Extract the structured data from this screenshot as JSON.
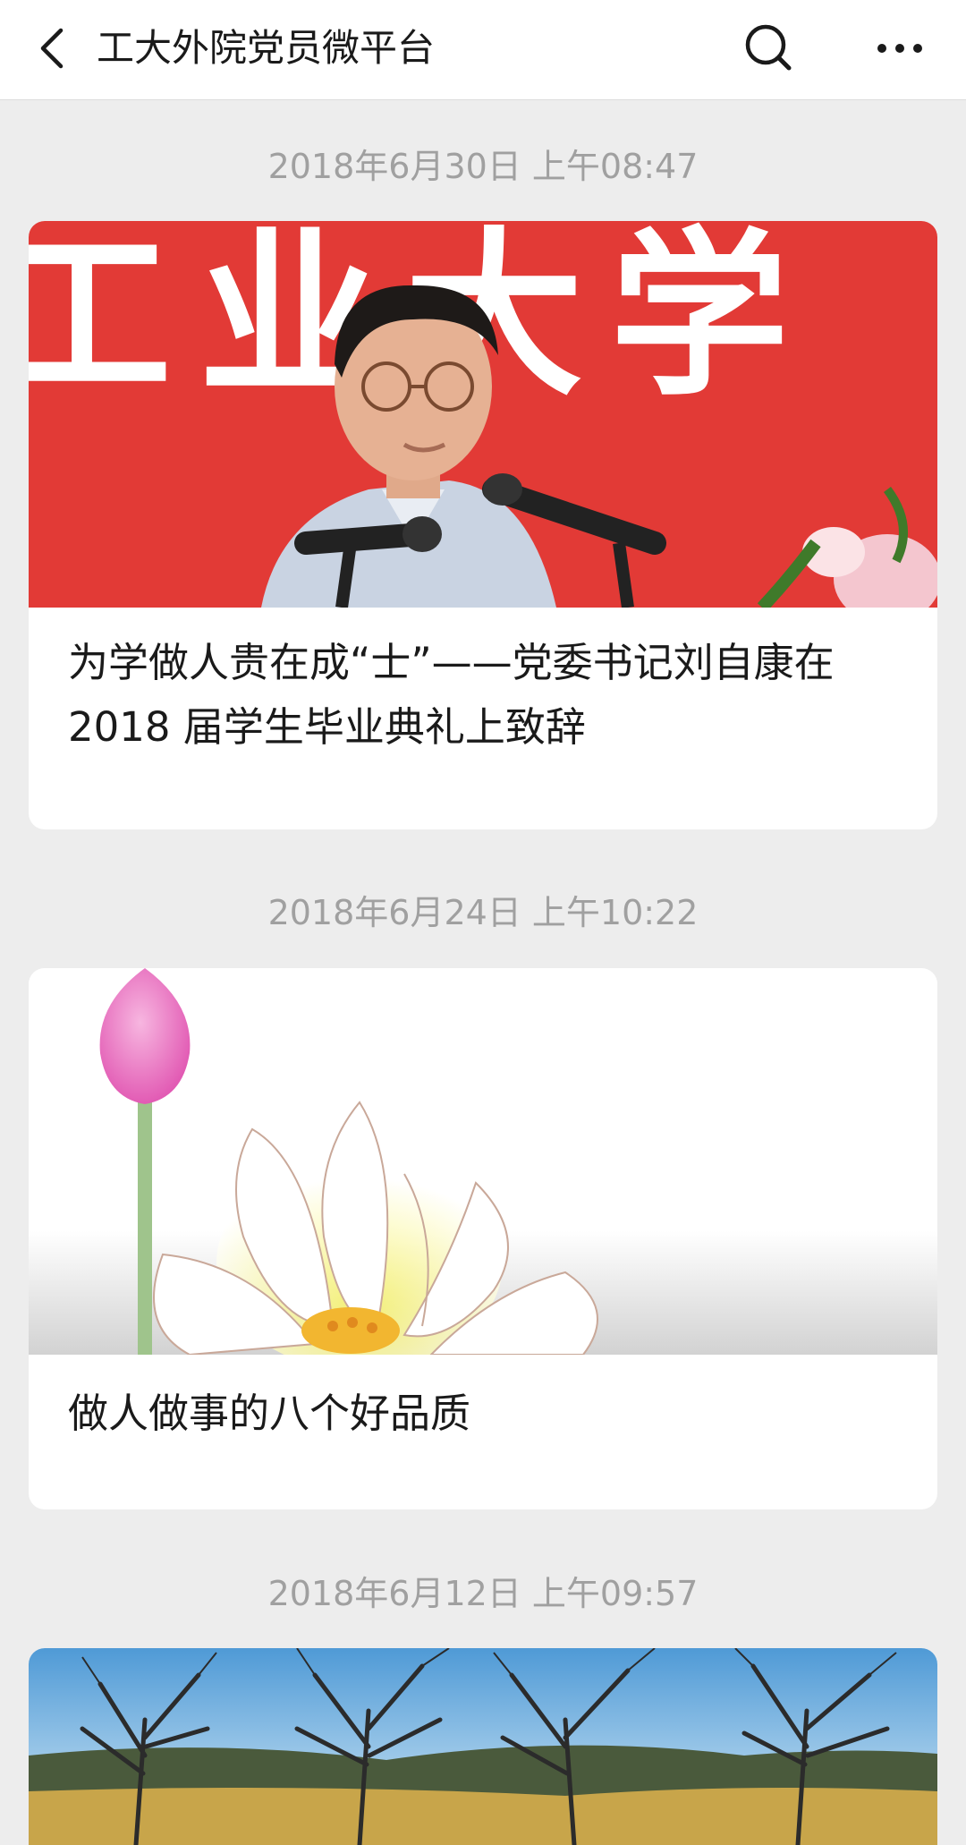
{
  "header": {
    "title": "工大外院党员微平台",
    "back_icon": "back-chevron-icon",
    "search_icon": "search-icon",
    "more_icon": "more-dots-icon"
  },
  "feed": {
    "items": [
      {
        "timestamp": "2018年6月30日 上午08:47",
        "title": "为学做人贵在成“士”——党委书记刘自康在 2018 届学生毕业典礼上致辞",
        "image": "speaker-at-podium-photo",
        "banner_text": "工业大学"
      },
      {
        "timestamp": "2018年6月24日 上午10:22",
        "title": "做人做事的八个好品质",
        "image": "lotus-flower-illustration"
      },
      {
        "timestamp": "2018年6月12日 上午09:57",
        "image": "trees-landscape-photo"
      }
    ]
  },
  "colors": {
    "background": "#ededed",
    "card": "#ffffff",
    "timestamp_text": "#a0a0a0",
    "title_text": "#1a1a1a",
    "banner_red": "#e23a36"
  }
}
